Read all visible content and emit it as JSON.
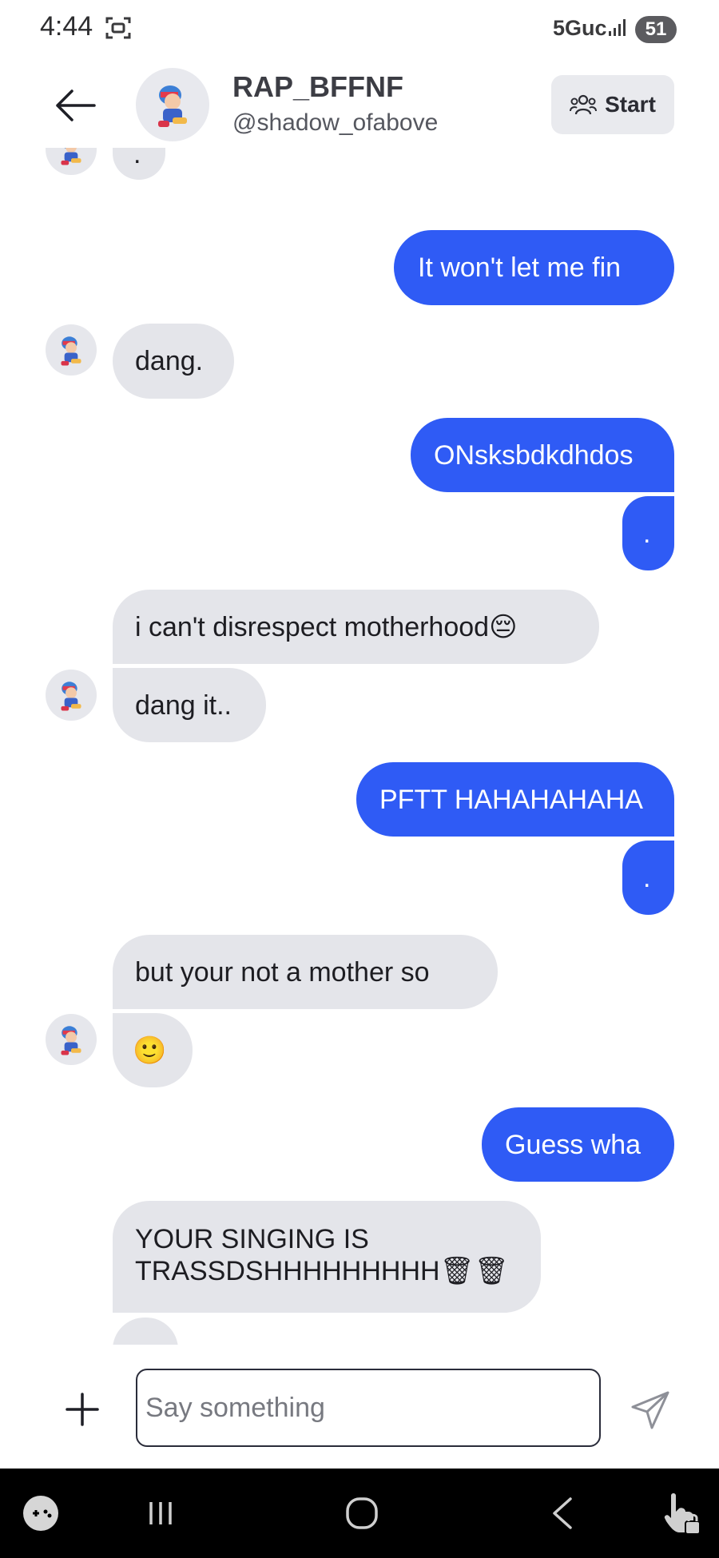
{
  "status_bar": {
    "time": "4:44",
    "network": "5Guc",
    "battery": "51"
  },
  "header": {
    "name": "RAP_BFFNF",
    "handle": "@shadow_ofabove",
    "start_label": "Start"
  },
  "messages": [
    {
      "side": "in",
      "text": "."
    },
    {
      "side": "out",
      "text": "It won't let me fin"
    },
    {
      "side": "in",
      "text": "dang."
    },
    {
      "side": "out",
      "text": "ONsksbdkdhdos"
    },
    {
      "side": "out",
      "text": "."
    },
    {
      "side": "in",
      "text": "i can't disrespect motherhood😔"
    },
    {
      "side": "in",
      "text": "dang it.."
    },
    {
      "side": "out",
      "text": "PFTT HAHAHAHAHA"
    },
    {
      "side": "out",
      "text": "."
    },
    {
      "side": "in",
      "text": "but your not a mother so"
    },
    {
      "side": "in",
      "text": "🙂"
    },
    {
      "side": "out",
      "text": "Guess wha"
    },
    {
      "side": "in",
      "text_line1": "YOUR SINGING IS",
      "text_line2": "TRASSDSHHHHHHHHH🗑🗑"
    }
  ],
  "composer": {
    "placeholder": "Say something",
    "add_icon": "plus-icon",
    "send_icon": "paper-plane-icon"
  },
  "nav_bar": {
    "icons": [
      "game-controller-icon",
      "recent-apps-icon",
      "home-icon",
      "back-icon",
      "touch-lock-icon"
    ]
  },
  "colors": {
    "outgoing_bubble": "#2f5bf5",
    "incoming_bubble": "#e4e5ea",
    "text": "#1d1d22"
  }
}
